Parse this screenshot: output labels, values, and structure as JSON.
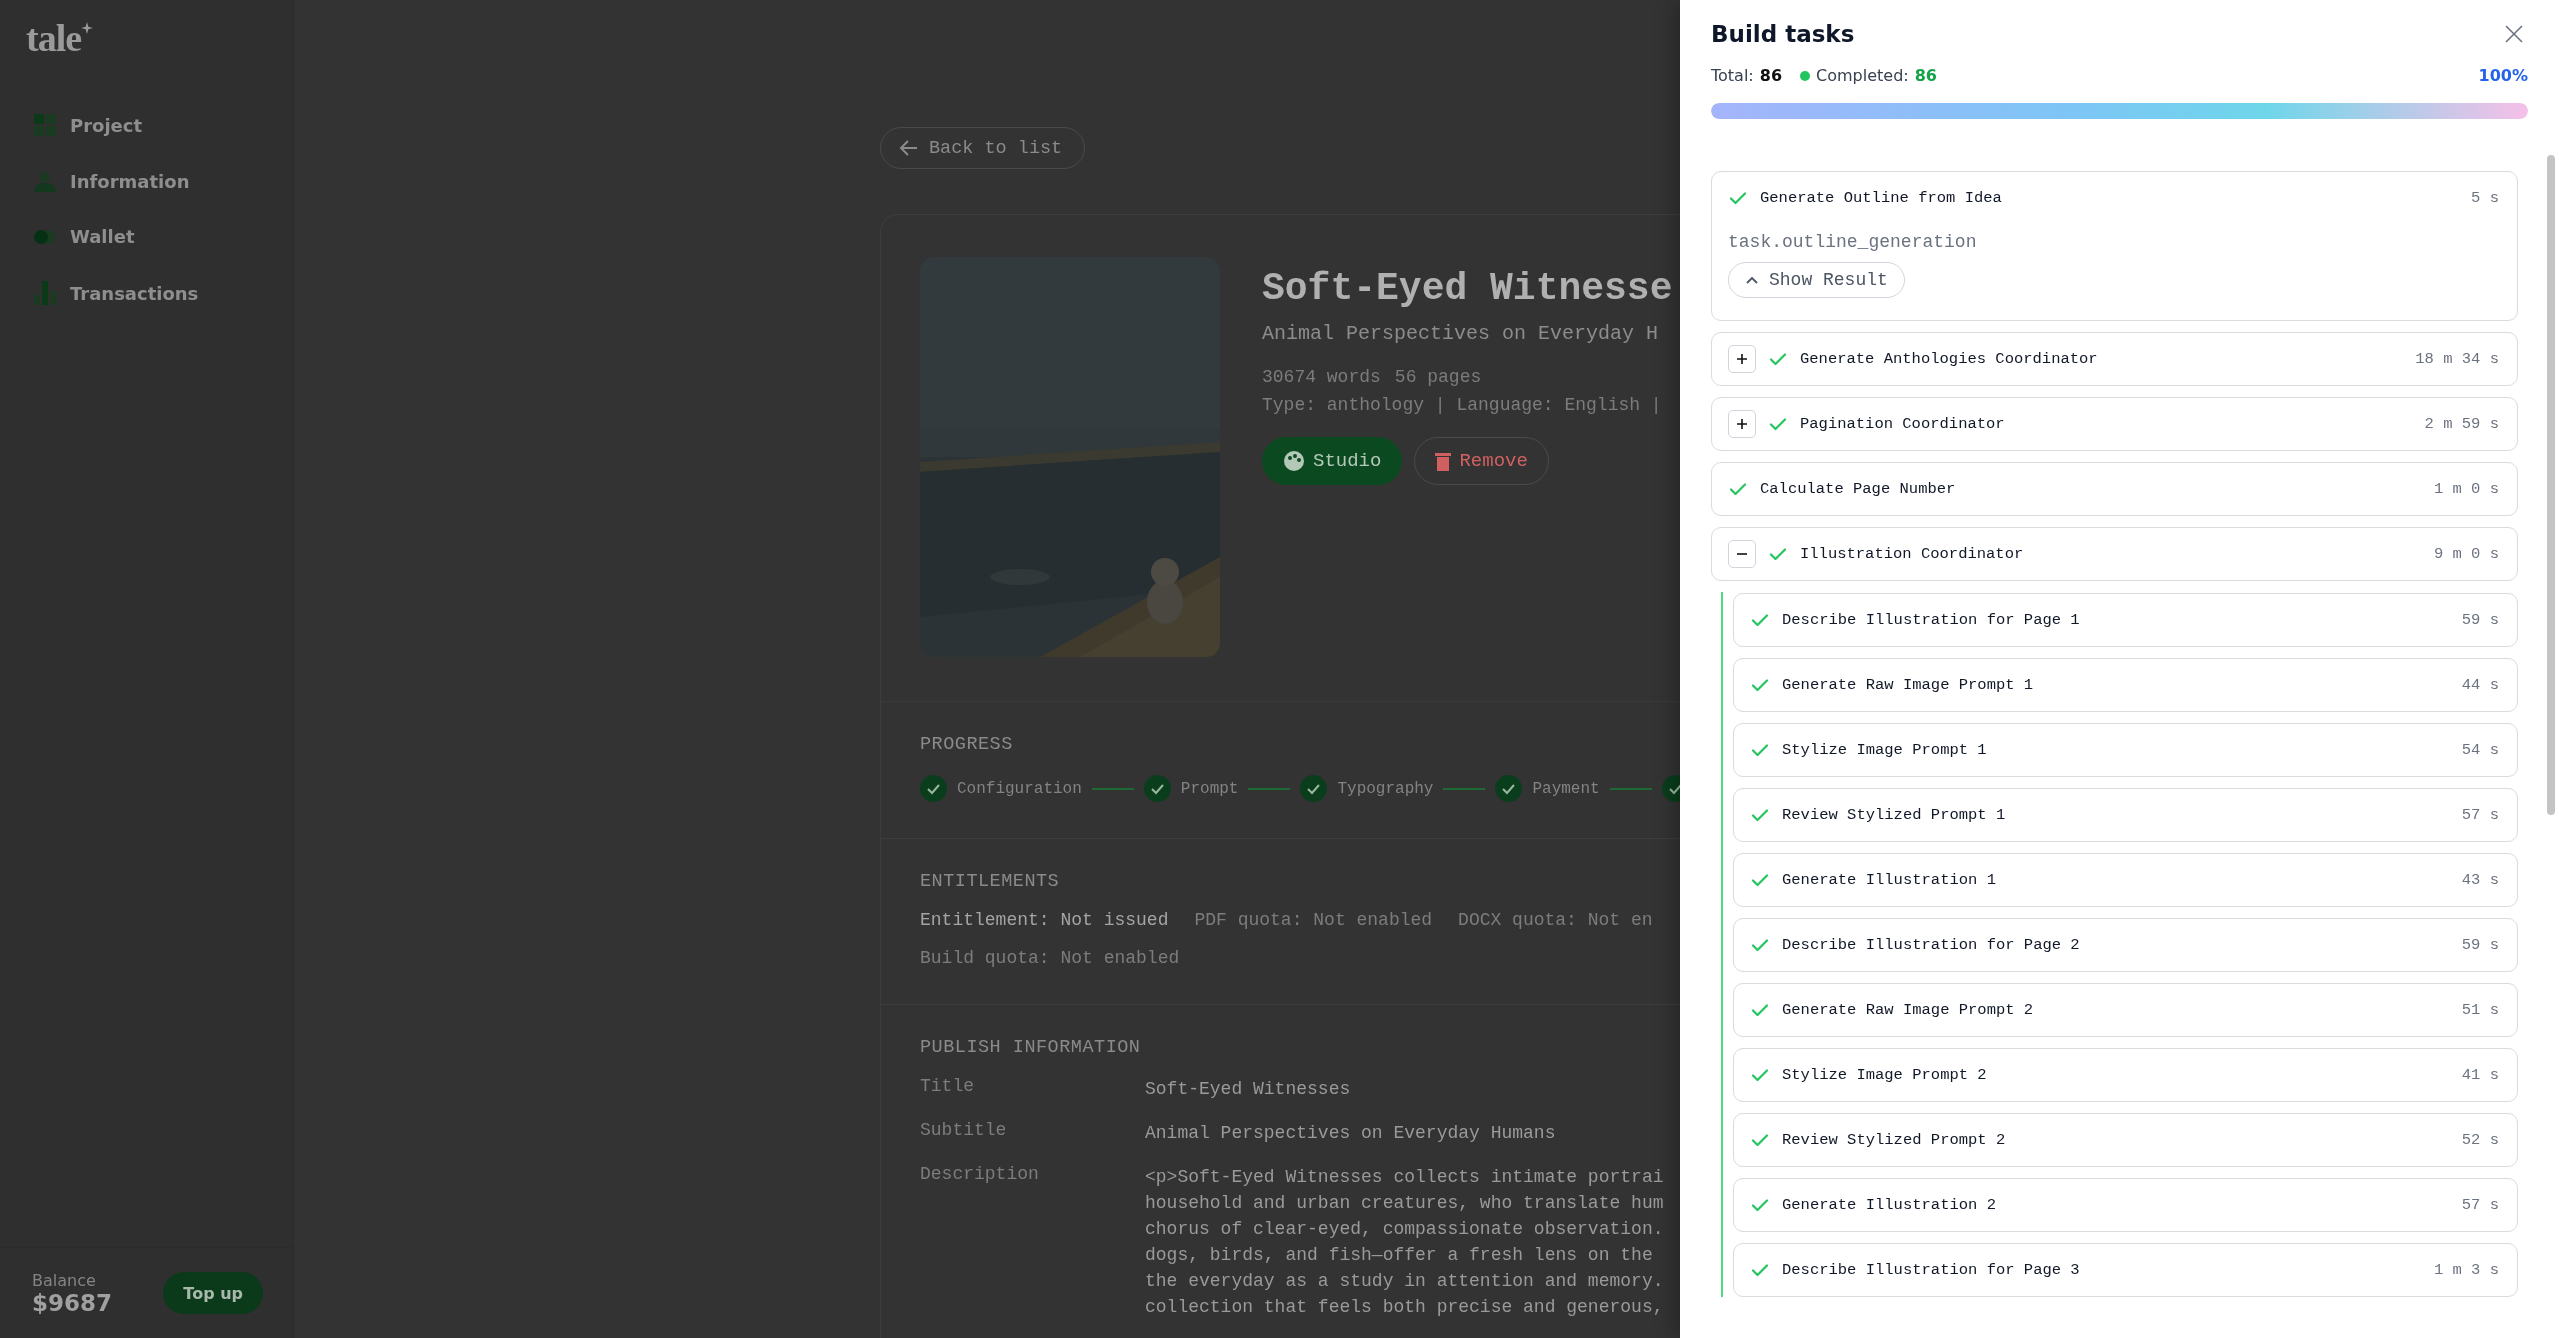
{
  "sidebar": {
    "logo": "tale",
    "items": [
      {
        "label": "Project"
      },
      {
        "label": "Information"
      },
      {
        "label": "Wallet"
      },
      {
        "label": "Transactions"
      }
    ],
    "balance": {
      "label": "Balance",
      "amount": "$9687",
      "button": "Top up"
    }
  },
  "main": {
    "back": "Back to list",
    "book": {
      "title": "Soft-Eyed Witnesse",
      "subtitle": "Animal Perspectives on Everyday H",
      "stats": [
        "30674 words",
        "56 pages"
      ],
      "details": "Type: anthology | Language: English |",
      "actions": [
        {
          "label": "Studio",
          "kind": "primary"
        },
        {
          "label": "Remove",
          "kind": "danger"
        }
      ]
    },
    "progress": {
      "heading": "PROGRESS",
      "steps": [
        {
          "label": "Configuration",
          "done": true
        },
        {
          "label": "Prompt",
          "done": true
        },
        {
          "label": "Typography",
          "done": true
        },
        {
          "label": "Payment",
          "done": true
        },
        {
          "done": true
        }
      ]
    },
    "entitlements": {
      "heading": "ENTITLEMENTS",
      "rows": [
        [
          {
            "text": "Entitlement: Not issued",
            "kind": "strong"
          },
          {
            "text": "PDF quota: Not enabled",
            "kind": "muted"
          },
          {
            "text": "DOCX quota: Not en",
            "kind": "muted"
          }
        ],
        [
          {
            "text": "Build quota: Not enabled",
            "kind": "muted"
          }
        ]
      ]
    },
    "publish": {
      "heading": "PUBLISH INFORMATION",
      "fields": [
        {
          "label": "Title",
          "lines": [
            "Soft-Eyed Witnesses"
          ]
        },
        {
          "label": "Subtitle",
          "lines": [
            "Animal Perspectives on Everyday Humans"
          ]
        },
        {
          "label": "Description",
          "lines": [
            "<p>Soft-Eyed Witnesses collects intimate portrai",
            "household and urban creatures, who translate hum",
            "chorus of clear-eyed, compassionate observation.",
            "dogs, birds, and fish—offer a fresh lens on the",
            "the everyday as a study in attention and memory.",
            "collection that feels both precise and generous,"
          ]
        }
      ]
    }
  },
  "drawer": {
    "title": "Build tasks",
    "total_label": "Total:",
    "total": "86",
    "completed_label": "Completed:",
    "completed": "86",
    "percent": "100%",
    "level": 1,
    "tasks": [
      {
        "kind": "detail",
        "name": "Generate Outline from Idea",
        "duration": "5 s",
        "done": true,
        "code": "task.outline_generation",
        "result_button": "Show Result"
      },
      {
        "kind": "group",
        "name": "Generate Anthologies Coordinator",
        "duration": "18 m 34 s",
        "done": true,
        "expanded": false
      },
      {
        "kind": "group",
        "name": "Pagination Coordinator",
        "duration": "2 m 59 s",
        "done": true,
        "expanded": false
      },
      {
        "kind": "leaf",
        "name": "Calculate Page Number",
        "duration": "1 m 0 s",
        "done": true
      },
      {
        "kind": "group",
        "name": "Illustration Coordinator",
        "duration": "9 m 0 s",
        "done": true,
        "expanded": true,
        "children": [
          {
            "kind": "leaf",
            "name": "Describe Illustration for Page 1",
            "duration": "59 s",
            "done": true
          },
          {
            "kind": "leaf",
            "name": "Generate Raw Image Prompt 1",
            "duration": "44 s",
            "done": true
          },
          {
            "kind": "leaf",
            "name": "Stylize Image Prompt 1",
            "duration": "54 s",
            "done": true
          },
          {
            "kind": "leaf",
            "name": "Review Stylized Prompt 1",
            "duration": "57 s",
            "done": true
          },
          {
            "kind": "leaf",
            "name": "Generate Illustration 1",
            "duration": "43 s",
            "done": true
          },
          {
            "kind": "leaf",
            "name": "Describe Illustration for Page 2",
            "duration": "59 s",
            "done": true
          },
          {
            "kind": "leaf",
            "name": "Generate Raw Image Prompt 2",
            "duration": "51 s",
            "done": true
          },
          {
            "kind": "leaf",
            "name": "Stylize Image Prompt 2",
            "duration": "41 s",
            "done": true
          },
          {
            "kind": "leaf",
            "name": "Review Stylized Prompt 2",
            "duration": "52 s",
            "done": true
          },
          {
            "kind": "leaf",
            "name": "Generate Illustration 2",
            "duration": "57 s",
            "done": true
          },
          {
            "kind": "leaf",
            "name": "Describe Illustration for Page 3",
            "duration": "1 m 3 s",
            "done": true
          }
        ]
      }
    ]
  }
}
